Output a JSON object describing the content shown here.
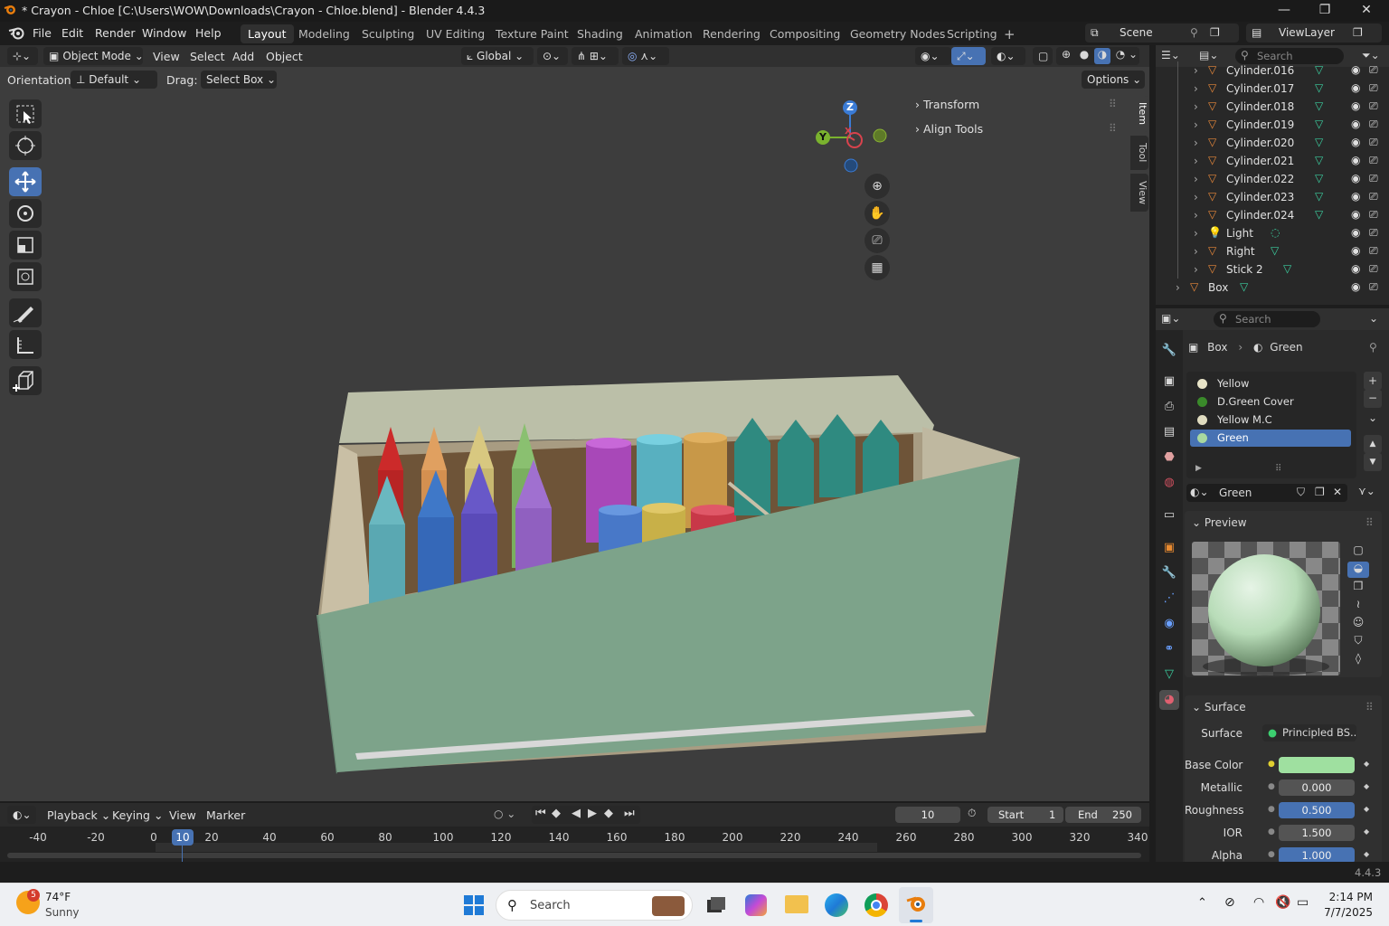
{
  "window": {
    "title": "* Crayon - Chloe [C:\\Users\\WOW\\Downloads\\Crayon - Chloe.blend] - Blender 4.4.3",
    "minimize": "—",
    "maximize": "❐",
    "close": "✕"
  },
  "menu": {
    "file": "File",
    "edit": "Edit",
    "render": "Render",
    "window": "Window",
    "help": "Help"
  },
  "workspaces": [
    "Layout",
    "Modeling",
    "Sculpting",
    "UV Editing",
    "Texture Paint",
    "Shading",
    "Animation",
    "Rendering",
    "Compositing",
    "Geometry Nodes",
    "Scripting"
  ],
  "scene": {
    "scene_name": "Scene",
    "view_layer": "ViewLayer"
  },
  "viewport_header": {
    "mode": "Object Mode",
    "view": "View",
    "select": "Select",
    "add": "Add",
    "object": "Object",
    "transform_orientation": "Global"
  },
  "tool_settings": {
    "orientation_label": "Orientation:",
    "orientation_value": "Default",
    "drag_label": "Drag:",
    "drag_value": "Select Box",
    "options": "Options"
  },
  "npanel": {
    "transform": "Transform",
    "align_tools": "Align Tools",
    "tabs": [
      "Item",
      "Tool",
      "View"
    ]
  },
  "gizmo": {
    "z": "Z",
    "y": "Y",
    "x": "X"
  },
  "outliner": {
    "search_placeholder": "Search",
    "rows": [
      {
        "name": "Cylinder.016",
        "type": "mesh"
      },
      {
        "name": "Cylinder.017",
        "type": "mesh"
      },
      {
        "name": "Cylinder.018",
        "type": "mesh"
      },
      {
        "name": "Cylinder.019",
        "type": "mesh"
      },
      {
        "name": "Cylinder.020",
        "type": "mesh"
      },
      {
        "name": "Cylinder.021",
        "type": "mesh"
      },
      {
        "name": "Cylinder.022",
        "type": "mesh"
      },
      {
        "name": "Cylinder.023",
        "type": "mesh"
      },
      {
        "name": "Cylinder.024",
        "type": "mesh"
      },
      {
        "name": "Light",
        "type": "light"
      },
      {
        "name": "Right",
        "type": "mesh"
      },
      {
        "name": "Stick 2",
        "type": "mesh"
      },
      {
        "name": "Box",
        "type": "mesh"
      }
    ]
  },
  "properties": {
    "search_placeholder": "Search",
    "breadcrumb_object": "Box",
    "breadcrumb_material": "Green",
    "material_slots": [
      "Yellow",
      "D.Green Cover",
      "Yellow M.C",
      "Green"
    ],
    "slot_colors": [
      "#e8e4c8",
      "#3a8a2a",
      "#e0dcc0",
      "#a8d8a0"
    ],
    "selected_slot": "Green",
    "material_name": "Green",
    "preview_title": "Preview",
    "surface_title": "Surface",
    "surface_label": "Surface",
    "surface_value": "Principled BS...",
    "fields": [
      {
        "label": "Base Color",
        "value": ""
      },
      {
        "label": "Metallic",
        "value": "0.000"
      },
      {
        "label": "Roughness",
        "value": "0.500"
      },
      {
        "label": "IOR",
        "value": "1.500"
      },
      {
        "label": "Alpha",
        "value": "1.000"
      }
    ],
    "base_color": "#9fe0a0"
  },
  "timeline": {
    "playback": "Playback",
    "keying": "Keying",
    "view": "View",
    "marker": "Marker",
    "current_frame": "10",
    "start_label": "Start",
    "start_value": "1",
    "end_label": "End",
    "end_value": "250",
    "ticks": [
      "-40",
      "-20",
      "0",
      "10",
      "20",
      "40",
      "60",
      "80",
      "100",
      "120",
      "140",
      "160",
      "180",
      "200",
      "220",
      "240",
      "260",
      "280",
      "300",
      "320",
      "340"
    ]
  },
  "status": {
    "version": "4.4.3"
  },
  "taskbar": {
    "weather_temp": "74°F",
    "weather_desc": "Sunny",
    "weather_badge": "5",
    "search_placeholder": "Search",
    "time": "2:14 PM",
    "date": "7/7/2025"
  },
  "icons": {
    "accent_blue": "#4772b3",
    "viewport_bg": "#3d3d3d"
  }
}
